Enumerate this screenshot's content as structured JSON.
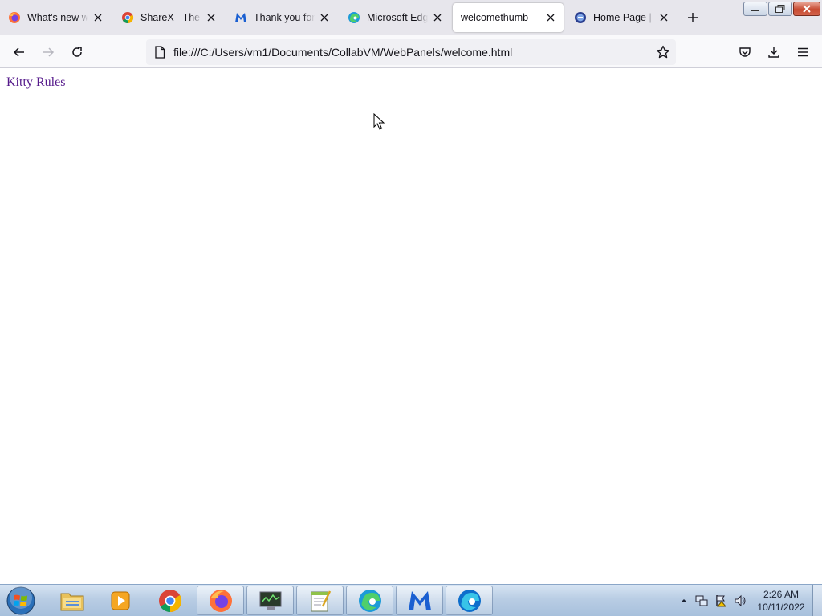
{
  "window": {
    "tabs": [
      {
        "title": "What's new with Firefox",
        "icon": "firefox-icon"
      },
      {
        "title": "ShareX - The best free screen",
        "icon": "chrome-icon"
      },
      {
        "title": "Thank you for downloading",
        "icon": "malwarebytes-icon"
      },
      {
        "title": "Microsoft Edge",
        "icon": "edge-icon"
      },
      {
        "title": "welcomethumb",
        "icon": "none",
        "active": true
      },
      {
        "title": "Home Page | Security",
        "icon": "site-icon"
      }
    ]
  },
  "navbar": {
    "url": "file:///C:/Users/vm1/Documents/CollabVM/WebPanels/welcome.html"
  },
  "page": {
    "links": [
      "Kitty",
      "Rules"
    ]
  },
  "taskbar": {
    "apps": [
      "explorer",
      "media-player",
      "chrome",
      "firefox",
      "task-manager",
      "notepad",
      "edge",
      "malwarebytes",
      "edge-beta"
    ],
    "clock_time": "2:26 AM",
    "clock_date": "10/11/2022"
  },
  "colors": {
    "link_visited": "#551a8b",
    "tab_strip": "#e7e6ec",
    "taskbar": "#b9cde4"
  }
}
